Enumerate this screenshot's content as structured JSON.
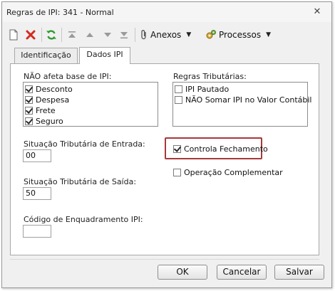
{
  "window": {
    "title": "Regras de IPI: 341 - Normal"
  },
  "toolbar": {
    "new_icon": "new-document-icon",
    "delete_icon": "red-x-icon",
    "refresh_icon": "green-refresh-icon",
    "first_icon": "first-record-icon",
    "prev_icon": "previous-record-icon",
    "next_icon": "next-record-icon",
    "last_icon": "last-record-icon",
    "attachments_label": "Anexos",
    "processes_label": "Processos"
  },
  "tabs": [
    {
      "label": "Identificação",
      "active": false
    },
    {
      "label": "Dados IPI",
      "active": true
    }
  ],
  "nao_afeta": {
    "label": "NÃO afeta base de IPI:",
    "items": [
      {
        "label": "Desconto",
        "checked": true
      },
      {
        "label": "Despesa",
        "checked": true
      },
      {
        "label": "Frete",
        "checked": true
      },
      {
        "label": "Seguro",
        "checked": true
      }
    ]
  },
  "regras": {
    "label": "Regras Tributárias:",
    "items": [
      {
        "label": "IPI Pautado",
        "checked": false
      },
      {
        "label": "NÃO Somar IPI no Valor Contábil",
        "checked": false
      }
    ]
  },
  "sit_entrada": {
    "label": "Situação Tributária de Entrada:",
    "value": "00"
  },
  "sit_saida": {
    "label": "Situação Tributária de Saída:",
    "value": "50"
  },
  "cod_enq": {
    "label": "Código de Enquadramento IPI:",
    "value": ""
  },
  "controla_fechamento": {
    "label": "Controla Fechamento",
    "checked": true,
    "highlight_color": "#a8383a"
  },
  "operacao_complementar": {
    "label": "Operação Complementar",
    "checked": false
  },
  "buttons": {
    "ok": "OK",
    "cancel": "Cancelar",
    "save": "Salvar"
  }
}
